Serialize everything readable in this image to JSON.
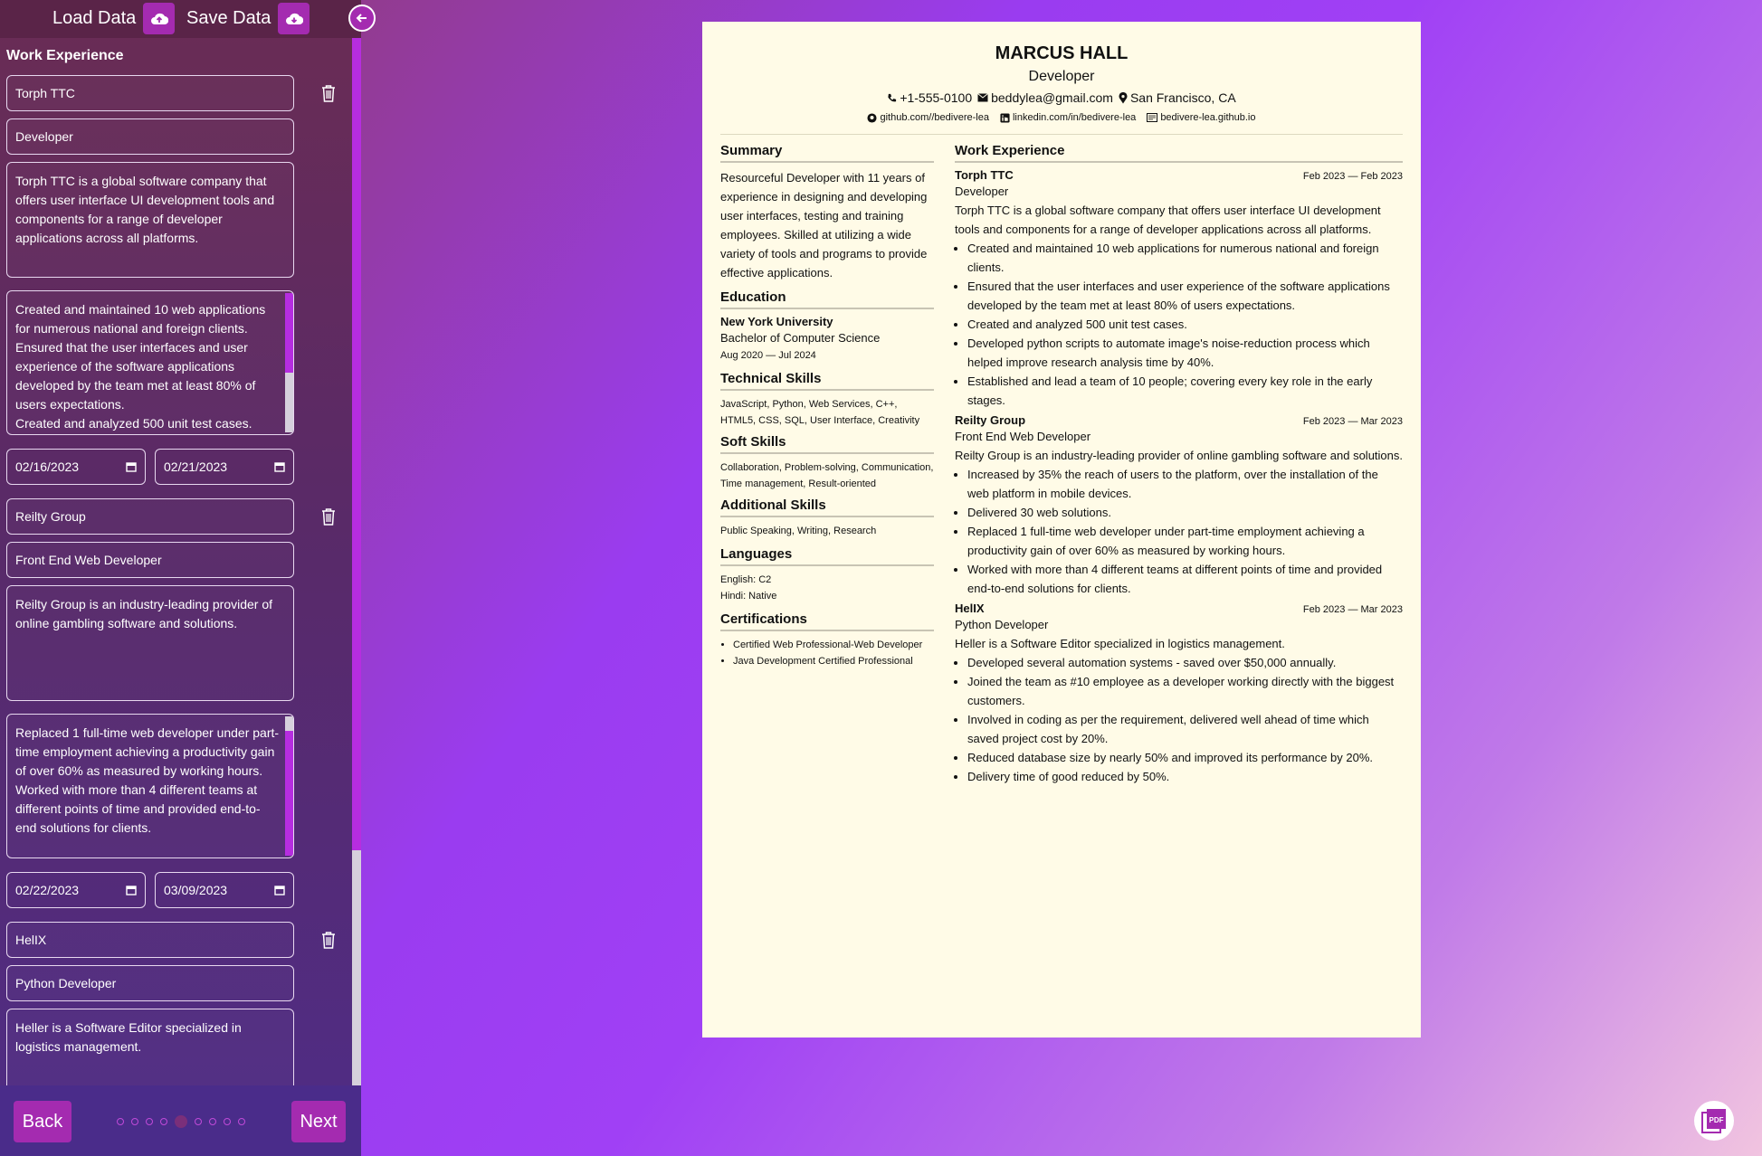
{
  "topbar": {
    "load_label": "Load Data",
    "save_label": "Save Data"
  },
  "form": {
    "section_title": "Work Experience",
    "entries": [
      {
        "company": "Torph TTC",
        "position": "Developer",
        "description": "Torph TTC is a global software company that offers user interface UI development tools and components for a range of developer applications across all platforms.",
        "achievements": "Created and maintained 10 web applications for numerous national and foreign clients.\nEnsured that the user interfaces and user experience of the software applications developed by the team met at least 80% of users expectations.\nCreated and analyzed 500 unit test cases.",
        "start_date": "02/16/2023",
        "end_date": "02/21/2023"
      },
      {
        "company": "Reilty Group",
        "position": "Front End Web Developer",
        "description": "Reilty Group is an industry-leading provider of online gambling software and solutions.",
        "achievements": "Replaced 1 full-time web developer under part-time employment achieving a productivity gain of over 60% as measured by working hours.\nWorked with more than 4 different teams at different points of time and provided end-to-end solutions for clients.",
        "start_date": "02/22/2023",
        "end_date": "03/09/2023"
      },
      {
        "company": "HelIX",
        "position": "Python Developer",
        "description": "Heller is a Software Editor specialized in logistics management."
      }
    ]
  },
  "nav": {
    "back_label": "Back",
    "next_label": "Next",
    "total_steps": 9,
    "current_step": 5
  },
  "resume": {
    "name": "MARCUS HALL",
    "role": "Developer",
    "phone": "+1-555-0100",
    "email": "beddylea@gmail.com",
    "location": "San Francisco, CA",
    "github": "github.com//bedivere-lea",
    "linkedin": "linkedin.com/in/bedivere-lea",
    "website": "bedivere-lea.github.io",
    "summary_title": "Summary",
    "summary": "Resourceful Developer with 11 years of experience in designing and developing user interfaces, testing and training employees. Skilled at utilizing a wide variety of tools and programs to provide effective applications.",
    "education_title": "Education",
    "education": {
      "school": "New York University",
      "degree": "Bachelor of Computer Science",
      "dates": "Aug 2020 — Jul 2024"
    },
    "tech_title": "Technical Skills",
    "tech_skills": "JavaScript, Python, Web Services, C++, HTML5, CSS, SQL, User Interface, Creativity",
    "soft_title": "Soft Skills",
    "soft_skills": "Collaboration, Problem-solving, Communication, Time management, Result-oriented",
    "additional_title": "Additional Skills",
    "additional_skills": "Public Speaking, Writing, Research",
    "languages_title": "Languages",
    "languages": [
      "English: C2",
      "Hindi: Native"
    ],
    "cert_title": "Certifications",
    "certifications": [
      "Certified Web Professional-Web Developer",
      "Java Development Certified Professional"
    ],
    "work_title": "Work Experience",
    "jobs": [
      {
        "company": "Torph TTC",
        "dates": "Feb 2023 — Feb 2023",
        "position": "Developer",
        "description": "Torph TTC is a global software company that offers user interface UI develop­ment tools and components for a range of developer applications across all platforms.",
        "bullets": [
          "Created and maintained 10 web applications for numerous national and foreign clients.",
          "Ensured that the user interfaces and user experience of the software applications developed by the team met at least 80% of users expectations.",
          "Created and analyzed 500 unit test cases.",
          "Developed python scripts to automate image's noise-reduction process which helped improve research analysis time by 40%.",
          "Established and lead a team of 10 people; covering every key role in the early stages."
        ]
      },
      {
        "company": "Reilty Group",
        "dates": "Feb 2023 — Mar 2023",
        "position": "Front End Web Developer",
        "description": "Reilty Group is an industry-leading provider of online gambling software and solutions.",
        "bullets": [
          "Increased by 35% the reach of users to the platform, over the installation of the web platform in mobile devices.",
          "Delivered 30 web solutions.",
          "Replaced 1 full-time web developer under part-time employment achieving a productivity gain of over 60% as measured by working hours.",
          "Worked with more than 4 different teams at different points of time and provided end-to-end solutions for clients."
        ]
      },
      {
        "company": "HelIX",
        "dates": "Feb 2023 — Mar 2023",
        "position": "Python Developer",
        "description": "Heller is a Software Editor specialized in logistics management.",
        "bullets": [
          "Developed several automation systems - saved over $50,000 annually.",
          "Joined the team as #10 employee as a developer working directly with the biggest customers.",
          "Involved in coding as per the requirement, delivered well ahead of time which saved project cost by 20%.",
          "Reduced database size by nearly 50% and improved its performance by 20%.",
          "Delivery time of good reduced by 50%."
        ]
      }
    ]
  },
  "pdf_button_label": "PDF",
  "colors": {
    "accent": "#a42bb0",
    "resume_bg": "#fffbe7"
  }
}
